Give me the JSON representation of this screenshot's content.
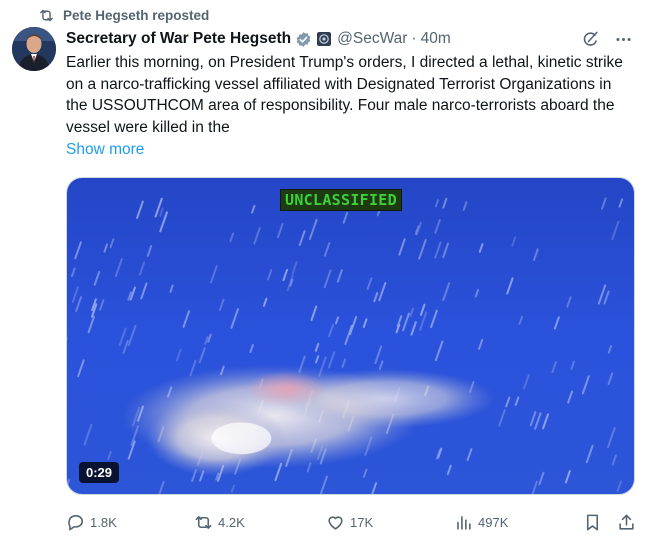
{
  "repost": {
    "label": "Pete Hegseth reposted"
  },
  "author": {
    "name": "Secretary of War Pete Hegseth",
    "handle": "@SecWar",
    "separator": "·",
    "time": "40m"
  },
  "tweet": {
    "text": "Earlier this morning, on President Trump's orders, I directed a lethal, kinetic strike on a narco-trafficking vessel affiliated with Designated Terrorist Organizations in the USSOUTHCOM area of responsibility. Four male narco-terrorists aboard the vessel were killed in the",
    "show_more": "Show more"
  },
  "media": {
    "overlay_text": "UNCLASSIFIED",
    "duration": "0:29"
  },
  "actions": {
    "replies": "1.8K",
    "reposts": "4.2K",
    "likes": "17K",
    "views": "497K"
  },
  "icons": {
    "repost": "repost-icon",
    "verified": "verified-badge-icon",
    "affiliate": "affiliate-badge-icon",
    "grok": "grok-icon",
    "more": "more-icon",
    "reply": "reply-icon",
    "like": "heart-icon",
    "views": "views-icon",
    "bookmark": "bookmark-icon",
    "share": "share-icon"
  },
  "colors": {
    "link": "#1d9bf0",
    "muted": "#536471",
    "overlay_text": "#3bd13b",
    "ocean": "#2b4fd8"
  }
}
